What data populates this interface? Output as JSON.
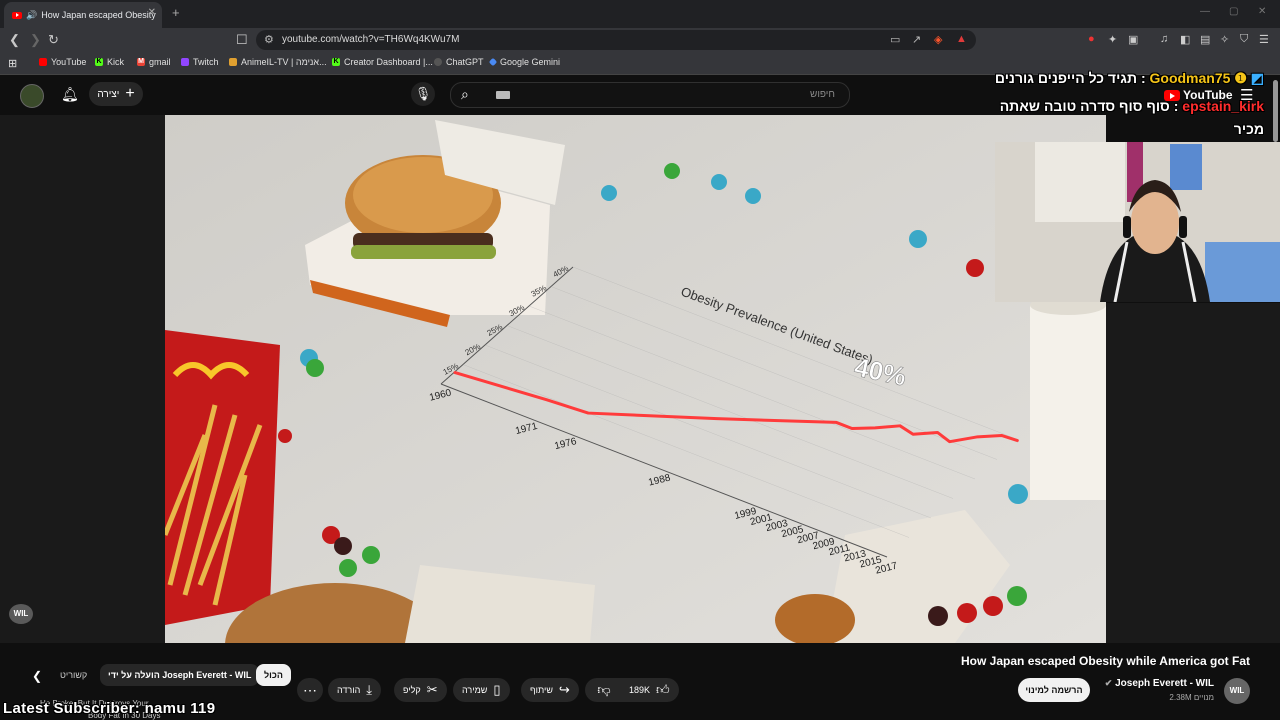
{
  "browser": {
    "tab_title": "How Japan escaped Obesity",
    "new_tab": "+",
    "window_controls": [
      "—",
      "▢",
      "✕"
    ],
    "url": "youtube.com/watch?v=TH6Wq4KWu7M",
    "bookmarks": [
      {
        "label": "YouTube",
        "color": "#ff0000",
        "icon": "youtube-icon"
      },
      {
        "label": "Kick",
        "color": "#53fc18",
        "icon": "kick-icon"
      },
      {
        "label": "gmail",
        "color": "#ea4335",
        "icon": "gmail-icon"
      },
      {
        "label": "Twitch",
        "color": "#9146ff",
        "icon": "twitch-icon"
      },
      {
        "label": "AnimeIL-TV | אנימה...",
        "color": "#e0a030",
        "icon": "anime-icon"
      },
      {
        "label": "Creator Dashboard |...",
        "color": "#53fc18",
        "icon": "kick-icon"
      },
      {
        "label": "ChatGPT",
        "color": "#555555",
        "icon": "chatgpt-icon"
      },
      {
        "label": "Google Gemini",
        "color": "#4a8af4",
        "icon": "gemini-icon"
      }
    ]
  },
  "youtube": {
    "create_label": "יצירה",
    "search_placeholder": "חיפוש",
    "logo_text": "YouTube"
  },
  "chat_overlay": {
    "line1_message": "תגיד כל הייפנים גורנים :",
    "line1_user": "Goodman75",
    "line2_message": "סוף סוף סדרה טובה שאתה :",
    "line2_user": "epstain_kirk",
    "line3": "מכיר"
  },
  "video": {
    "title": "How Japan escaped Obesity while America got Fat",
    "channel": "Joseph Everett - WIL",
    "channel_avatar_text": "WIL",
    "subscribers": "2.38M מנויים",
    "subscribe_label": "הרשמה למינוי",
    "likes": "189K",
    "share_label": "שיתוף",
    "save_label": "שמירה",
    "clip_label": "קליפ",
    "download_label": "הורדה",
    "chips": [
      "הכול",
      "הועלה על ידי Joseph Everett - WIL",
      "קשוריט"
    ],
    "wil_badge": "WIL"
  },
  "chart_data": {
    "type": "line",
    "title": "Obesity Prevalence (United States)",
    "annotation": "40%",
    "x_tick_labels": [
      "1960",
      "1971",
      "1976",
      "1988",
      "1999",
      "2001",
      "2003",
      "2005",
      "2007",
      "2009",
      "2011",
      "2013",
      "2015",
      "2017"
    ],
    "y_tick_labels": [
      "15%",
      "20%",
      "25%",
      "30%",
      "35%",
      "40%"
    ],
    "x": [
      1960,
      1971,
      1976,
      1988,
      1999,
      2001,
      2003,
      2005,
      2007,
      2009,
      2011,
      2013,
      2015,
      2017
    ],
    "series": [
      {
        "values": [
          13,
          14.5,
          15,
          22.9,
          30.5,
          30.5,
          32.2,
          34.3,
          33.7,
          35.7,
          34.9,
          37.7,
          39.6,
          39.8
        ]
      }
    ],
    "ylim": [
      10,
      40
    ],
    "line_color": "#ff3b3b"
  },
  "footer_overlay": {
    "latest_subscriber": "Latest Subscriber: namu 119",
    "underlay_1": "He Broke, But It Destroys Your",
    "underlay_2": "Body Fat In 30 Days"
  }
}
